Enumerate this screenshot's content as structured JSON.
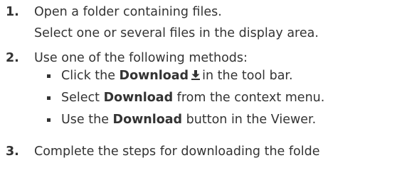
{
  "steps": [
    {
      "number": "1.",
      "lines": [
        "Open a folder containing files.",
        "Select one or several files in the display area."
      ]
    },
    {
      "number": "2.",
      "text": "Use one of the following methods:",
      "bullets": [
        {
          "before": "Click the ",
          "bold": "Download",
          "after_icon": "in the tool bar.",
          "icon": "download-icon"
        },
        {
          "before": "Select ",
          "bold": "Download",
          "after": " from the context menu."
        },
        {
          "before": "Use the ",
          "bold": "Download",
          "after": " button in the Viewer."
        }
      ]
    },
    {
      "number": "3.",
      "text": "Complete the steps for downloading the folde"
    }
  ]
}
